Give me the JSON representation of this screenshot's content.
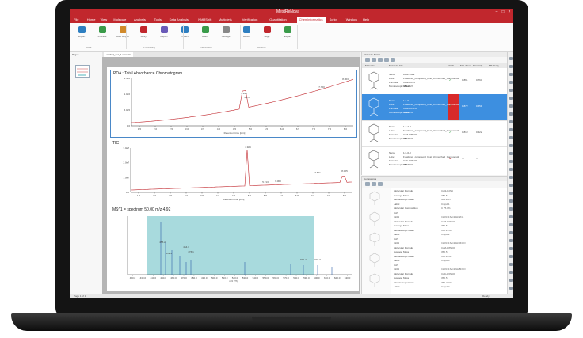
{
  "app": {
    "title": "MestReNova"
  },
  "menu": {
    "tabs": [
      "File",
      "Home",
      "View",
      "Molecule",
      "Analysis",
      "Tools",
      "Data Analysis",
      "NMRShift",
      "Multiplets",
      "Verification",
      "Quantitation",
      "Cheminformatics",
      "Script",
      "Window",
      "Help"
    ],
    "active_index": 11
  },
  "document": {
    "tab": "untitled_doc_1.mnova*"
  },
  "chromatogram": {
    "title": "PDA : Total Absorbance Chromatogram",
    "xlabel": "Retention time [min]",
    "y_ticks": [
      "1.5e6",
      "1.0e6",
      "5.0e5",
      "0.0"
    ],
    "x_ticks": [
      "1.5",
      "2.0",
      "2.5",
      "3.0",
      "3.5",
      "4.0",
      "4.5",
      "5.0",
      "5.5",
      "6.0",
      "6.5",
      "7.0",
      "7.5",
      "8.0"
    ],
    "peaks": [
      "4.930",
      "4.976",
      "7.750",
      "8.063"
    ]
  },
  "tic": {
    "title": "TIC",
    "xlabel": "Retention time [min]",
    "y_ticks": [
      "3.0e7",
      "2.0e7",
      "1.0e7",
      "0.0"
    ],
    "x_ticks": [
      "1.5",
      "2.0",
      "2.5",
      "3.0",
      "3.5",
      "4.0",
      "4.5",
      "5.0",
      "5.5",
      "6.0",
      "6.5",
      "7.0",
      "7.5",
      "8.0"
    ],
    "peaks": [
      "4.925",
      "5.713",
      "6.060",
      "7.621",
      "8.005"
    ]
  },
  "ms": {
    "title": "MS^1 = spectrum 50.00 m/z 4.92",
    "xlabel": "m/z (Th)",
    "x_ticks": [
      "420.0",
      "430.0",
      "440.0",
      "450.0",
      "460.0",
      "470.0",
      "480.0",
      "490.0",
      "500.0",
      "510.0",
      "520.0",
      "530.0",
      "540.0",
      "550.0",
      "560.0",
      "570.0",
      "580.0",
      "590.0",
      "600.0",
      "610.0",
      "620.0",
      "630.0"
    ],
    "peaks": [
      "455.2",
      "459.4",
      "464.3",
      "476.1",
      "591.2",
      "607.3"
    ]
  },
  "molecule_table": {
    "panel_title": "Molecule Match",
    "headers": [
      "Molecule",
      "Molecule Info",
      "Match",
      "Mol. Score",
      "Similarity",
      "MS Purity"
    ],
    "rows": [
      {
        "name": "1822-1629",
        "label": "Fusidanol_compound_best_Unmatched_Compounds",
        "formula": "C24H32N4",
        "mass": "384.2627",
        "match": "✔",
        "score": "0.891",
        "similarity": "0.764",
        "selected": false,
        "red": false
      },
      {
        "name": "1-6-9",
        "label": "Fusidanol_compound_best_Unmatched_Compounds",
        "formula": "C23H30N2O",
        "mass": "350.2358",
        "match": "✔",
        "score": "0.872",
        "similarity": "0.651",
        "selected": true,
        "red": true
      },
      {
        "name": "1-7-2-8",
        "label": "Fusidanol_compound_best_Unmatched_Compounds",
        "formula": "C22H28N3O",
        "mass": "350.2231",
        "match": "✔",
        "score": "0.813",
        "similarity": "0.422",
        "selected": false,
        "red": false
      },
      {
        "name": "1-5-6-3",
        "label": "Fusidanol_compound_best_Unmatched_Compounds",
        "formula": "C21H26N4O",
        "mass": "350.2107",
        "match": "✖",
        "score": "—",
        "similarity": "—",
        "selected": false,
        "red": false
      }
    ]
  },
  "compounds": {
    "panel_title": "Compounds",
    "headers": [
      "Molecule",
      "Properties"
    ],
    "props": [
      [
        "Molecular Formula",
        "C24H32N4"
      ],
      [
        "Average Mass",
        "384.5"
      ],
      [
        "Monoisotopic Mass",
        "384.2627"
      ],
      [
        "Label",
        "Cmpd 1"
      ],
      [
        "Molecular Composition",
        "C 75.0%"
      ],
      [
        "CAS",
        ""
      ],
      [
        "InChI",
        "InChI=1S/C24H32N4"
      ],
      [
        "Molecular Formula",
        "C23H30N2O"
      ],
      [
        "Average Mass",
        "350.5"
      ],
      [
        "Monoisotopic Mass",
        "350.2358"
      ],
      [
        "Label",
        "Cmpd 2"
      ],
      [
        "CAS",
        ""
      ],
      [
        "InChI",
        "InChI=1S/C23H30N2O"
      ],
      [
        "Molecular Formula",
        "C22H28N3O"
      ],
      [
        "Average Mass",
        "350.5"
      ],
      [
        "Monoisotopic Mass",
        "350.2231"
      ],
      [
        "Label",
        "Cmpd 3"
      ],
      [
        "CAS",
        ""
      ],
      [
        "InChI",
        "InChI=1S/C22H28N3O"
      ],
      [
        "Molecular Formula",
        "C21H26N4O"
      ],
      [
        "Average Mass",
        "350.5"
      ],
      [
        "Monoisotopic Mass",
        "350.2107"
      ],
      [
        "Label",
        "Cmpd 4"
      ]
    ]
  },
  "ribbon": {
    "buttons": [
      "Import",
      "Process",
      "Auto Report",
      "Verify",
      "Report",
      "Predict",
      "Batch",
      "Settings",
      "Match",
      "Align",
      "Export"
    ],
    "groups": [
      "Data",
      "Processing",
      "Verification",
      "Reports"
    ]
  },
  "status": {
    "left": "Page 1 of 1",
    "right": "Ready"
  },
  "colors": {
    "brand": "#c1272d",
    "selection": "#3d8fe0",
    "ms_highlight": "#a8dadd"
  }
}
